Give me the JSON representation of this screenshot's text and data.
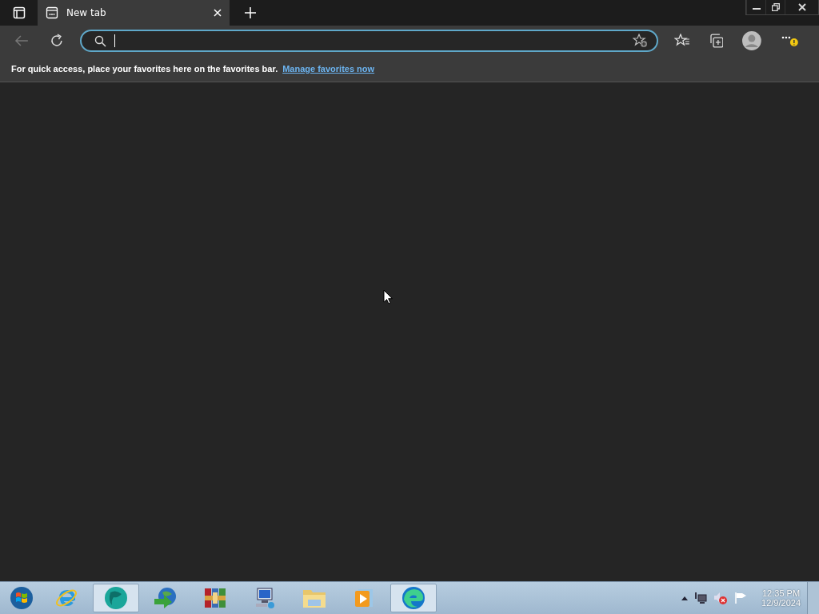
{
  "tabs": [
    {
      "title": "New tab",
      "selected": true
    }
  ],
  "favorites_bar": {
    "message": "For quick access, place your favorites here on the favorites bar.",
    "link": "Manage favorites now"
  },
  "taskbar": {
    "items": [
      {
        "kind": "ie",
        "selected": false
      },
      {
        "kind": "teal",
        "selected": true
      },
      {
        "kind": "download",
        "selected": false
      },
      {
        "kind": "archive",
        "selected": false
      },
      {
        "kind": "computer",
        "selected": false
      },
      {
        "kind": "folder",
        "selected": false
      },
      {
        "kind": "media",
        "selected": false
      },
      {
        "kind": "edge",
        "selected": true
      }
    ],
    "clock": {
      "time": "12:35 PM",
      "date": "12/9/2024"
    }
  }
}
